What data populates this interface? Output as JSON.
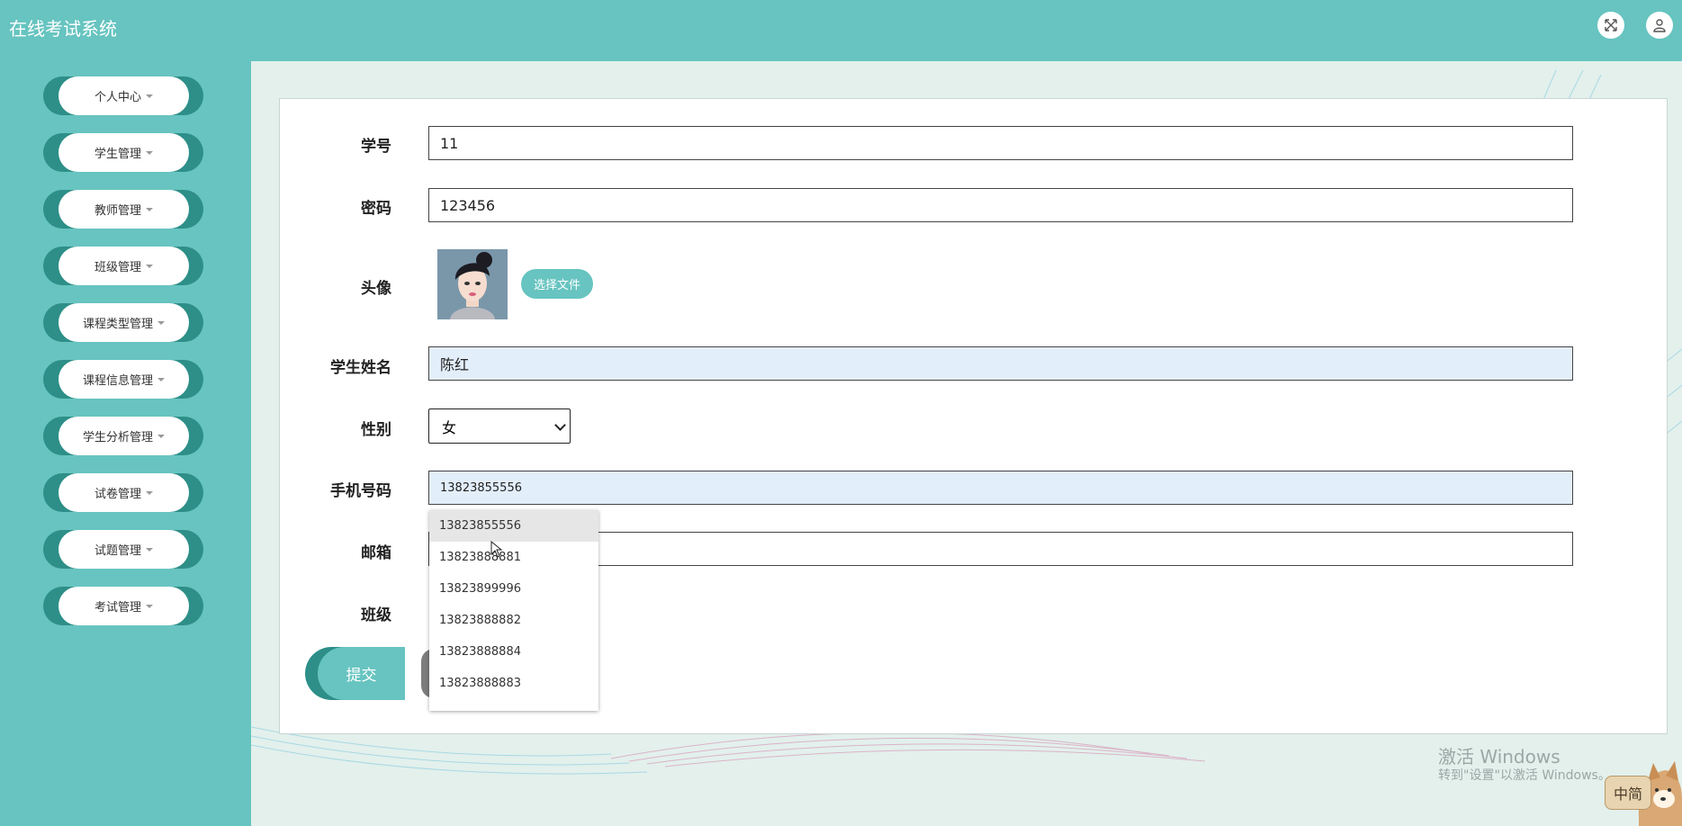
{
  "header": {
    "app_title": "在线考试系统",
    "icons": [
      "fullscreen-icon",
      "user-icon"
    ]
  },
  "sidebar": {
    "items": [
      {
        "label": "个人中心"
      },
      {
        "label": "学生管理"
      },
      {
        "label": "教师管理"
      },
      {
        "label": "班级管理"
      },
      {
        "label": "课程类型管理"
      },
      {
        "label": "课程信息管理"
      },
      {
        "label": "学生分析管理"
      },
      {
        "label": "试卷管理"
      },
      {
        "label": "试题管理"
      },
      {
        "label": "考试管理"
      }
    ]
  },
  "form": {
    "student_id": {
      "label": "学号",
      "value": "11"
    },
    "password": {
      "label": "密码",
      "value": "123456"
    },
    "avatar": {
      "label": "头像",
      "button_label": "选择文件"
    },
    "name": {
      "label": "学生姓名",
      "value": "陈红"
    },
    "gender": {
      "label": "性别",
      "value": "女"
    },
    "phone": {
      "label": "手机号码",
      "value": "13823855556"
    },
    "email": {
      "label": "邮箱",
      "value": ""
    },
    "class": {
      "label": "班级"
    },
    "submit_label": "提交"
  },
  "autocomplete": {
    "options": [
      "13823855556",
      "13823888881",
      "13823899996",
      "13823888882",
      "13823888884",
      "13823888883"
    ]
  },
  "watermark": {
    "line1": "激活 Windows",
    "line2": "转到\"设置\"以激活 Windows。"
  },
  "ime": {
    "label": "中简"
  },
  "colors": {
    "primary": "#67c4c0",
    "primary_dark": "#2d8f88",
    "background": "#e3f0ec",
    "autofill": "#e3eefb"
  }
}
